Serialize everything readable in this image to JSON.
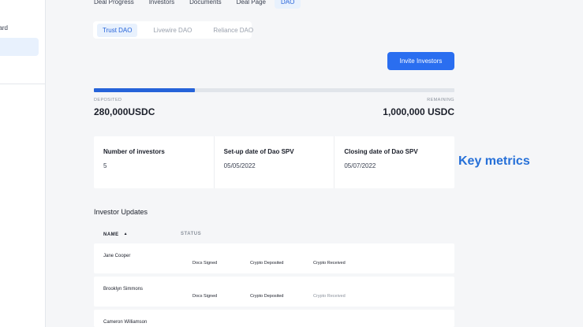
{
  "sidebar": {
    "partial_item_label": "ard"
  },
  "tabs": [
    {
      "label": "Deal Progress"
    },
    {
      "label": "Investors"
    },
    {
      "label": "Documents"
    },
    {
      "label": "Deal Page"
    },
    {
      "label": "DAO"
    }
  ],
  "active_tab": "DAO",
  "subtabs": [
    {
      "label": "Trust DAO"
    },
    {
      "label": "Livewire DAO"
    },
    {
      "label": "Reliance DAO"
    }
  ],
  "invite_button_label": "Invite Investors",
  "progress": {
    "fraction": 0.28,
    "deposited_label": "DEPOSITED",
    "deposited_value": "280,000USDC",
    "remaining_label": "REMAINING",
    "remaining_value": "1,000,000 USDC"
  },
  "metrics": [
    {
      "label": "Number of investors",
      "value": "5"
    },
    {
      "label": "Set-up date of Dao SPV",
      "value": "05/05/2022"
    },
    {
      "label": "Closing date of Dao SPV",
      "value": "05/07/2022"
    }
  ],
  "annotation": "Key metrics",
  "investor_updates": {
    "title": "Investor Updates",
    "columns": {
      "name": "NAME",
      "status": "STATUS"
    },
    "rows": [
      {
        "name": "Jane Cooper",
        "docs": "Docs Signed",
        "crypto": "Crypto Deposited",
        "received": "Crypto Received"
      },
      {
        "name": "Brooklyn Simmons",
        "docs": "Docs Signed",
        "crypto": "Crypto Deposited",
        "received": "Crypto Received"
      },
      {
        "name": "Cameron Williamson",
        "docs": "",
        "crypto": "",
        "received": ""
      }
    ]
  },
  "colors": {
    "accent": "#2563d9",
    "button": "#2a6ef0",
    "annotation": "#2670d8"
  }
}
